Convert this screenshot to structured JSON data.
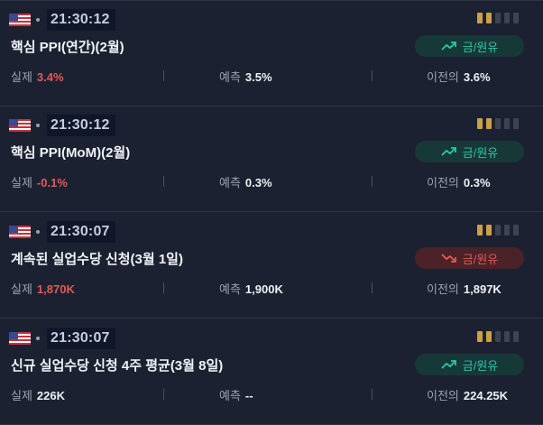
{
  "labels": {
    "actual": "실제",
    "forecast": "예측",
    "previous": "이전의"
  },
  "colors": {
    "up": "#2ec4a9",
    "down": "#e05a5a",
    "importance": "#caa04a"
  },
  "events": [
    {
      "flag_icon": "us-flag-icon",
      "time": "21:30:12",
      "title": "핵심 PPI(연간)(2월)",
      "importance": 2,
      "tag": {
        "label": "금/원유",
        "direction": "up"
      },
      "actual": "3.4%",
      "actual_tone": "red",
      "forecast": "3.5%",
      "previous": "3.6%"
    },
    {
      "flag_icon": "us-flag-icon",
      "time": "21:30:12",
      "title": "핵심 PPI(MoM)(2월)",
      "importance": 2,
      "tag": {
        "label": "금/원유",
        "direction": "up"
      },
      "actual": "-0.1%",
      "actual_tone": "red",
      "forecast": "0.3%",
      "previous": "0.3%"
    },
    {
      "flag_icon": "us-flag-icon",
      "time": "21:30:07",
      "title": "계속된 실업수당 신청(3월 1일)",
      "importance": 2,
      "tag": {
        "label": "금/원유",
        "direction": "down"
      },
      "actual": "1,870K",
      "actual_tone": "red",
      "forecast": "1,900K",
      "previous": "1,897K"
    },
    {
      "flag_icon": "us-flag-icon",
      "time": "21:30:07",
      "title": "신규 실업수당 신청 4주 평균(3월 8일)",
      "importance": 2,
      "tag": {
        "label": "금/원유",
        "direction": "up"
      },
      "actual": "226K",
      "actual_tone": "normal",
      "forecast": "--",
      "previous": "224.25K"
    }
  ]
}
